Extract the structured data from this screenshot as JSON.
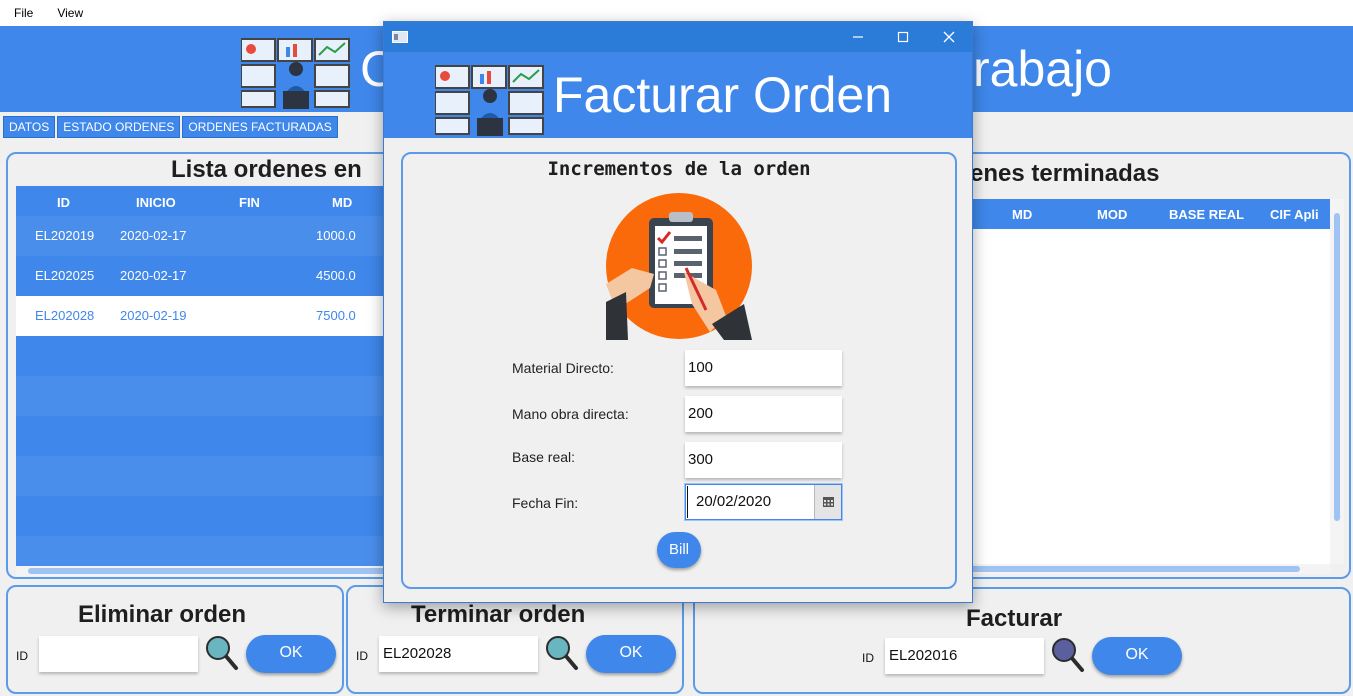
{
  "menu": {
    "file": "File",
    "view": "View"
  },
  "main": {
    "title_left": "C",
    "title_right": "rabajo",
    "tabs": [
      "DATOS",
      "ESTADO ORDENES",
      "ORDENES FACTURADAS"
    ]
  },
  "left_list": {
    "title": "Lista ordenes en",
    "headers": [
      "ID",
      "INICIO",
      "FIN",
      "MD"
    ],
    "rows": [
      {
        "id": "EL202019",
        "inicio": "2020-02-17",
        "fin": "",
        "md": "1000.0"
      },
      {
        "id": "EL202025",
        "inicio": "2020-02-17",
        "fin": "",
        "md": "4500.0"
      },
      {
        "id": "EL202028",
        "inicio": "2020-02-19",
        "fin": "",
        "md": "7500.0"
      }
    ]
  },
  "right_list": {
    "title": "enes terminadas",
    "headers": [
      "MD",
      "MOD",
      "BASE REAL",
      "CIF Apli"
    ]
  },
  "eliminar": {
    "title": "Eliminar orden",
    "id_label": "ID",
    "value": "",
    "ok": "OK"
  },
  "terminar": {
    "title": "Terminar orden",
    "id_label": "ID",
    "value": "EL202028",
    "ok": "OK"
  },
  "facturar": {
    "title": "Facturar",
    "id_label": "ID",
    "value": "EL202016",
    "ok": "OK"
  },
  "dialog": {
    "title": "Facturar Orden",
    "section_title": "Incrementos de la orden",
    "fields": [
      {
        "label": "Material Directo:",
        "value": "100"
      },
      {
        "label": "Mano obra directa:",
        "value": "200"
      },
      {
        "label": "Base real:",
        "value": "300"
      },
      {
        "label": "Fecha Fin:",
        "value": "20/02/2020"
      }
    ],
    "bill_button": "Bill"
  },
  "icons": {
    "minimize": "minimize-icon",
    "maximize": "maximize-icon",
    "close": "close-icon",
    "calendar": "calendar-icon",
    "search": "magnifier-icon",
    "clipboard": "clipboard-checklist-icon",
    "monitor_logo": "operator-monitors-logo"
  },
  "colors": {
    "accent": "#3f87ea",
    "titlebar": "#2b7bd8",
    "orange": "#fb6a0a"
  }
}
